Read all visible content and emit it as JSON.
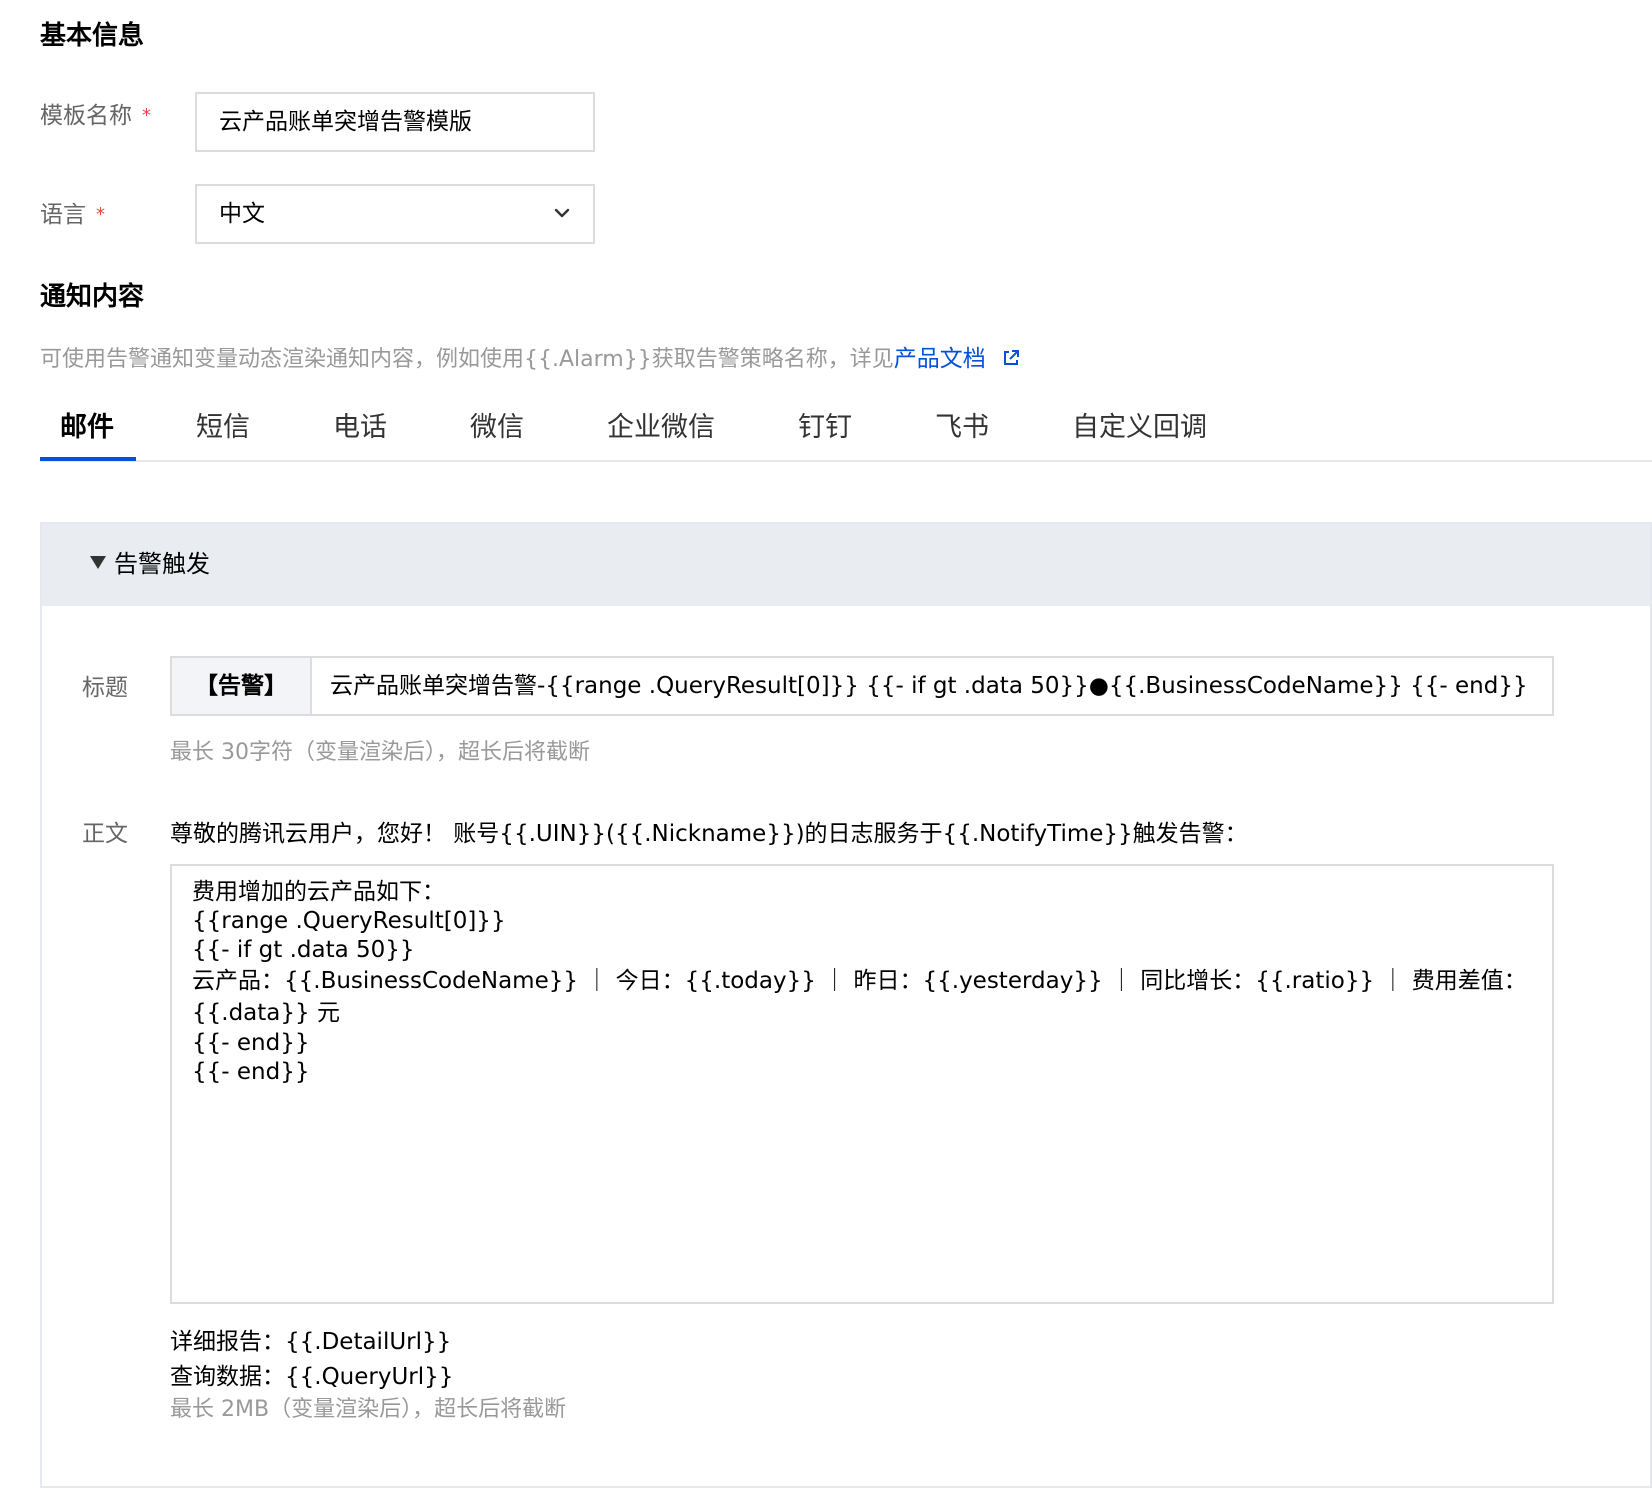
{
  "basic_info": {
    "title": "基本信息",
    "template_name_label": "模板名称",
    "template_name_value": "云产品账单突增告警模版",
    "language_label": "语言",
    "language_value": "中文",
    "required_mark": "*"
  },
  "notify": {
    "title": "通知内容",
    "hint_text": "可使用告警通知变量动态渲染通知内容，例如使用{{.Alarm}}获取告警策略名称，详见",
    "hint_link": "产品文档"
  },
  "tabs": [
    {
      "label": "邮件",
      "active": true
    },
    {
      "label": "短信",
      "active": false
    },
    {
      "label": "电话",
      "active": false
    },
    {
      "label": "微信",
      "active": false
    },
    {
      "label": "企业微信",
      "active": false
    },
    {
      "label": "钉钉",
      "active": false
    },
    {
      "label": "飞书",
      "active": false
    },
    {
      "label": "自定义回调",
      "active": false
    }
  ],
  "panel": {
    "header": "告警触发",
    "subject_label": "标题",
    "subject_prefix": "【告警】",
    "subject_value": "云产品账单突增告警-{{range .QueryResult[0]}} {{- if gt .data 50}}●{{.BusinessCodeName}} {{- end}} {{- end}}",
    "subject_hint": "最长 30字符（变量渲染后），超长后将截断",
    "body_label": "正文",
    "body_intro": "尊敬的腾讯云用户，您好！ 账号{{.UIN}}({{.Nickname}})的日志服务于{{.NotifyTime}}触发告警：",
    "body_lines": [
      "费用增加的云产品如下：",
      "{{range .QueryResult[0]}}",
      "{{- if gt .data 50}}",
      "云产品：{{.BusinessCodeName}} ｜ 今日：{{.today}} ｜ 昨日：{{.yesterday}} ｜ 同比增长：{{.ratio}} ｜ 费用差值：{{.data}} 元",
      "{{- end}}",
      "{{- end}}"
    ],
    "detail_report": "详细报告：{{.DetailUrl}}",
    "query_data": "查询数据：{{.QueryUrl}}",
    "body_hint": "最长 2MB（变量渲染后），超长后将截断"
  },
  "icons": {
    "dropdown": "chevron-down-icon",
    "external_link": "external-link-icon",
    "collapse": "caret-down-icon"
  },
  "colors": {
    "accent": "#0052d9",
    "required": "#e54545",
    "panel_header_bg": "#e9ecf1"
  }
}
